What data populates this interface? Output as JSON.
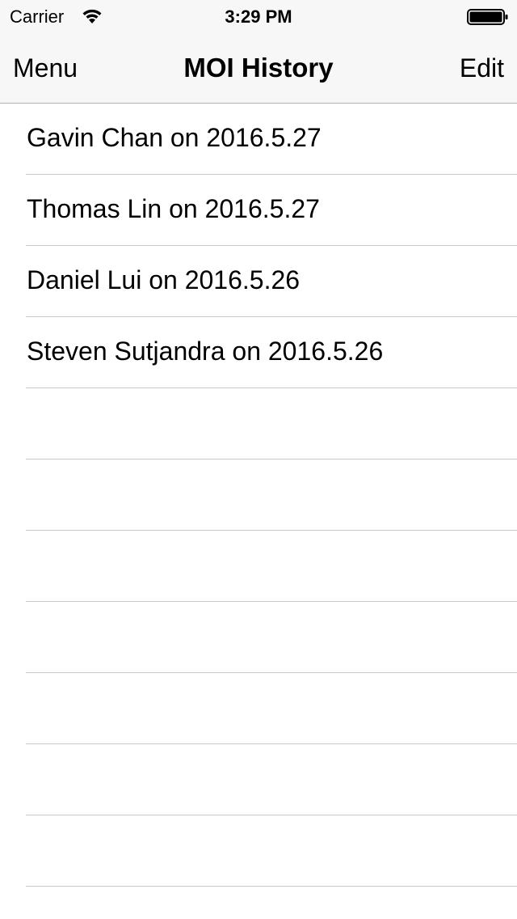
{
  "status_bar": {
    "carrier": "Carrier",
    "time": "3:29 PM",
    "wifi_icon": "wifi-icon",
    "battery_icon": "battery-icon"
  },
  "nav_bar": {
    "left_label": "Menu",
    "title": "MOI History",
    "right_label": "Edit"
  },
  "list": {
    "items": [
      "Gavin Chan on 2016.5.27",
      "Thomas Lin on 2016.5.27",
      "Daniel Lui on 2016.5.26",
      "Steven Sutjandra on 2016.5.26"
    ]
  },
  "colors": {
    "bar_background": "#f7f7f7",
    "separator": "#c8c7cc",
    "text": "#000000"
  }
}
